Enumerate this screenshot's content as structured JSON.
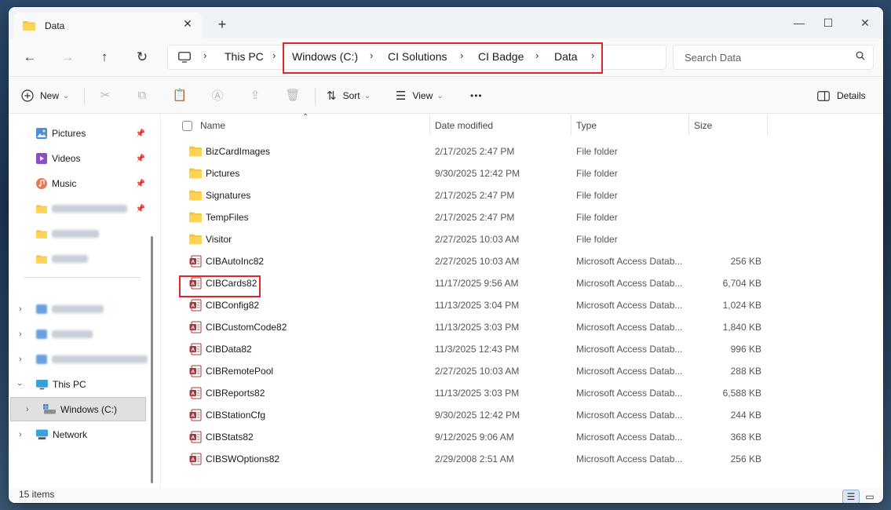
{
  "window": {
    "tab_title": "Data",
    "tab_close": "✕",
    "new_tab": "+",
    "minimize": "—",
    "maximize": "☐",
    "close": "✕"
  },
  "nav": {
    "back": "←",
    "forward": "→",
    "up": "↑",
    "refresh": "↻"
  },
  "address": {
    "this_pc": "This PC",
    "crumbs": [
      "Windows (C:)",
      "CI Solutions",
      "CI Badge",
      "Data"
    ],
    "chevron": "›"
  },
  "search": {
    "placeholder": "Search Data",
    "icon": "⚲"
  },
  "toolbar": {
    "new_label": "New",
    "sort_label": "Sort",
    "view_label": "View",
    "more_label": "•••",
    "details_label": "Details",
    "dropdown": "⌄"
  },
  "sidebar": {
    "quick": [
      {
        "label": "Pictures",
        "icon": "pictures-icon"
      },
      {
        "label": "Videos",
        "icon": "videos-icon"
      },
      {
        "label": "Music",
        "icon": "music-icon"
      }
    ],
    "pin": "📌",
    "this_pc": "This PC",
    "windows_c": "Windows (C:)",
    "network": "Network"
  },
  "columns": {
    "name": "Name",
    "date": "Date modified",
    "type": "Type",
    "size": "Size"
  },
  "files": [
    {
      "name": "BizCardImages",
      "date": "2/17/2025 2:47 PM",
      "type": "File folder",
      "size": "",
      "kind": "folder"
    },
    {
      "name": "Pictures",
      "date": "9/30/2025 12:42 PM",
      "type": "File folder",
      "size": "",
      "kind": "folder"
    },
    {
      "name": "Signatures",
      "date": "2/17/2025 2:47 PM",
      "type": "File folder",
      "size": "",
      "kind": "folder"
    },
    {
      "name": "TempFiles",
      "date": "2/17/2025 2:47 PM",
      "type": "File folder",
      "size": "",
      "kind": "folder"
    },
    {
      "name": "Visitor",
      "date": "2/27/2025 10:03 AM",
      "type": "File folder",
      "size": "",
      "kind": "folder"
    },
    {
      "name": "CIBAutoInc82",
      "date": "2/27/2025 10:03 AM",
      "type": "Microsoft Access Datab...",
      "size": "256 KB",
      "kind": "access"
    },
    {
      "name": "CIBCards82",
      "date": "11/17/2025 9:56 AM",
      "type": "Microsoft Access Datab...",
      "size": "6,704 KB",
      "kind": "access"
    },
    {
      "name": "CIBConfig82",
      "date": "11/13/2025 3:04 PM",
      "type": "Microsoft Access Datab...",
      "size": "1,024 KB",
      "kind": "access"
    },
    {
      "name": "CIBCustomCode82",
      "date": "11/13/2025 3:03 PM",
      "type": "Microsoft Access Datab...",
      "size": "1,840 KB",
      "kind": "access"
    },
    {
      "name": "CIBData82",
      "date": "11/3/2025 12:43 PM",
      "type": "Microsoft Access Datab...",
      "size": "996 KB",
      "kind": "access"
    },
    {
      "name": "CIBRemotePool",
      "date": "2/27/2025 10:03 AM",
      "type": "Microsoft Access Datab...",
      "size": "288 KB",
      "kind": "access"
    },
    {
      "name": "CIBReports82",
      "date": "11/13/2025 3:03 PM",
      "type": "Microsoft Access Datab...",
      "size": "6,588 KB",
      "kind": "access"
    },
    {
      "name": "CIBStationCfg",
      "date": "9/30/2025 12:42 PM",
      "type": "Microsoft Access Datab...",
      "size": "244 KB",
      "kind": "access"
    },
    {
      "name": "CIBStats82",
      "date": "9/12/2025 9:06 AM",
      "type": "Microsoft Access Datab...",
      "size": "368 KB",
      "kind": "access"
    },
    {
      "name": "CIBSWOptions82",
      "date": "2/29/2008 2:51 AM",
      "type": "Microsoft Access Datab...",
      "size": "256 KB",
      "kind": "access"
    }
  ],
  "status": {
    "count": "15 items"
  },
  "colors": {
    "highlight": "#e0262b",
    "folder": "#f5c542",
    "access": "#a4373a"
  }
}
